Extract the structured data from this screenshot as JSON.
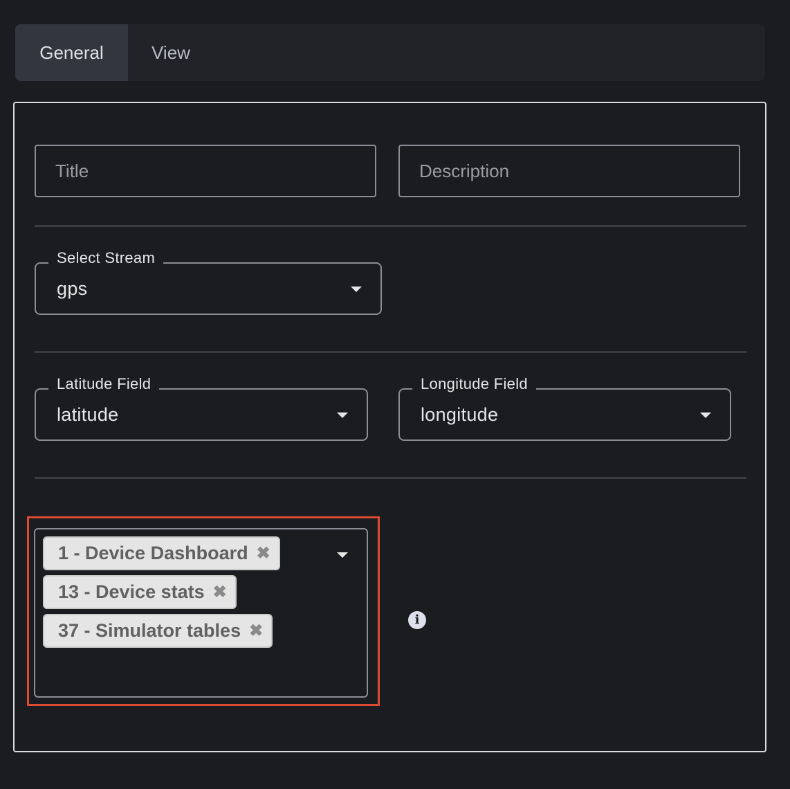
{
  "tabs": [
    {
      "label": "General",
      "active": true
    },
    {
      "label": "View",
      "active": false
    }
  ],
  "fields": {
    "title": {
      "placeholder": "Title",
      "value": ""
    },
    "description": {
      "placeholder": "Description",
      "value": ""
    }
  },
  "stream": {
    "label": "Select Stream",
    "value": "gps"
  },
  "latitude": {
    "label": "Latitude Field",
    "value": "latitude"
  },
  "longitude": {
    "label": "Longitude Field",
    "value": "longitude"
  },
  "dashboards": {
    "selected": [
      {
        "label": "1 - Device Dashboard",
        "remove_icon": "✖"
      },
      {
        "label": "13 - Device stats",
        "remove_icon": "✖"
      },
      {
        "label": "37 - Simulator tables",
        "remove_icon": "✖"
      }
    ],
    "info_icon": "i"
  },
  "colors": {
    "background": "#1b1c20",
    "highlight": "#dc4a32",
    "chip": "#e5e5e5"
  }
}
